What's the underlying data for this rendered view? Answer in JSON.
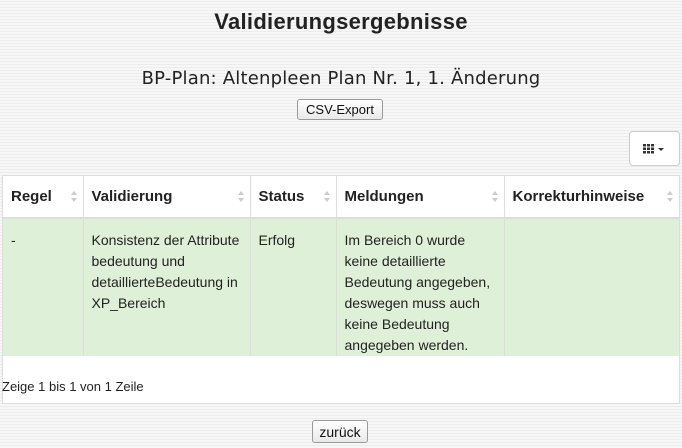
{
  "page": {
    "title": "Validierungsergebnisse",
    "subtitle": "BP-Plan: Altenpleen Plan Nr. 1, 1. Änderung"
  },
  "toolbar": {
    "csv_export_label": "CSV-Export",
    "columns_icon": "grid-icon",
    "back_label": "zurück"
  },
  "table": {
    "columns": [
      "Regel",
      "Validierung",
      "Status",
      "Meldungen",
      "Korrekturhinweise"
    ],
    "rows": [
      {
        "regel": "-",
        "validierung": "Konsistenz der Attribute bedeutung und detaillierteBedeutung in XP_Bereich",
        "status": "Erfolg",
        "meldungen": "Im Bereich 0 wurde keine detaillierte Bedeutung angegeben, deswegen muss auch keine Bedeutung angegeben werden.",
        "korrekturhinweise": ""
      }
    ],
    "row_color": "#dff0d8",
    "pagination_text": "Zeige 1 bis 1 von 1 Zeile"
  }
}
